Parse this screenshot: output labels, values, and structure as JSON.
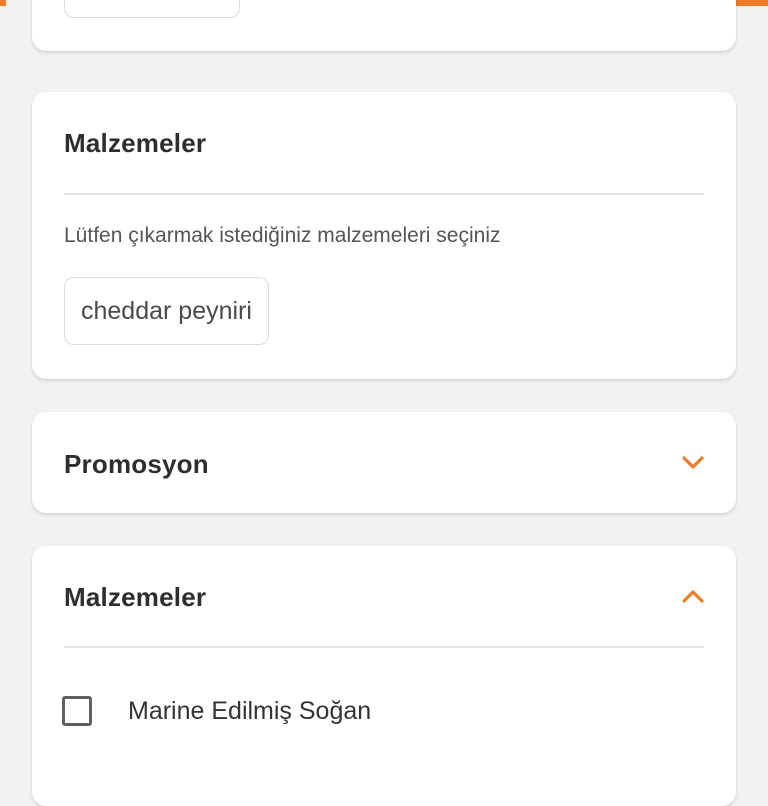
{
  "theme": {
    "accent": "#ec7c2a",
    "background": "#f2f2f2",
    "card": "#ffffff"
  },
  "ingredients_card": {
    "title": "Malzemeler",
    "instruction": "Lütfen çıkarmak istediğiniz malzemeleri seçiniz",
    "selected_chip": "cheddar peyniri"
  },
  "promotion_card": {
    "title": "Promosyon",
    "toggle_icon": "chevron-down-icon",
    "expanded": false
  },
  "ingredients_list_card": {
    "title": "Malzemeler",
    "toggle_icon": "chevron-up-icon",
    "expanded": true,
    "items": [
      {
        "label": "Marine Edilmiş Soğan",
        "checked": false
      }
    ]
  }
}
